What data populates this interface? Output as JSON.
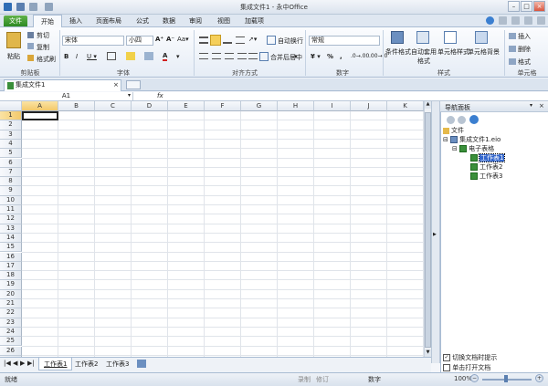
{
  "window": {
    "title": "集成文件1 - 永中Office"
  },
  "menu": {
    "file": "文件",
    "items": [
      "开始",
      "插入",
      "页面布局",
      "公式",
      "数据",
      "审阅",
      "视图",
      "加载项"
    ]
  },
  "ribbon": {
    "clipboard": {
      "paste": "粘贴",
      "cut": "剪切",
      "copy": "复制",
      "format_painter": "格式刷",
      "label": "剪贴板"
    },
    "font": {
      "family": "宋体",
      "size": "小四",
      "label": "字体"
    },
    "alignment": {
      "wrap": "自动换行",
      "merge": "合并后居中",
      "label": "对齐方式"
    },
    "number": {
      "format": "常规",
      "label": "数字"
    },
    "styles": {
      "conditional": "条件格式",
      "table_format": "自动套用格式",
      "cell_style": "单元格样式",
      "cell_bg": "单元格背景",
      "label": "样式"
    },
    "cells": {
      "insert": "插入",
      "delete": "删除",
      "format": "格式",
      "label": "单元格"
    }
  },
  "doc_tab": {
    "name": "集成文件1"
  },
  "formula": {
    "cell_ref": "A1",
    "fx": "fx",
    "value": ""
  },
  "grid": {
    "columns": [
      "A",
      "B",
      "C",
      "D",
      "E",
      "F",
      "G",
      "H",
      "I",
      "J",
      "K"
    ],
    "rows": [
      "1",
      "2",
      "3",
      "4",
      "5",
      "6",
      "7",
      "8",
      "9",
      "10",
      "11",
      "12",
      "13",
      "14",
      "15",
      "16",
      "17",
      "18",
      "19",
      "20",
      "21",
      "22",
      "23",
      "24",
      "25",
      "26",
      "27"
    ]
  },
  "sheet_tabs": [
    "工作表1",
    "工作表2",
    "工作表3"
  ],
  "nav_panel": {
    "title": "导航面板",
    "root": "文件",
    "file": "集成文件1.eio",
    "workbook": "电子表格",
    "sheets": [
      "工作表1",
      "工作表2",
      "工作表3"
    ],
    "opt_toggle": "切换文档时提示",
    "opt_single_click": "单击打开文档"
  },
  "status": {
    "ready": "就绪",
    "record": "录制",
    "revise": "修订",
    "num": "数字",
    "zoom": "100%"
  }
}
